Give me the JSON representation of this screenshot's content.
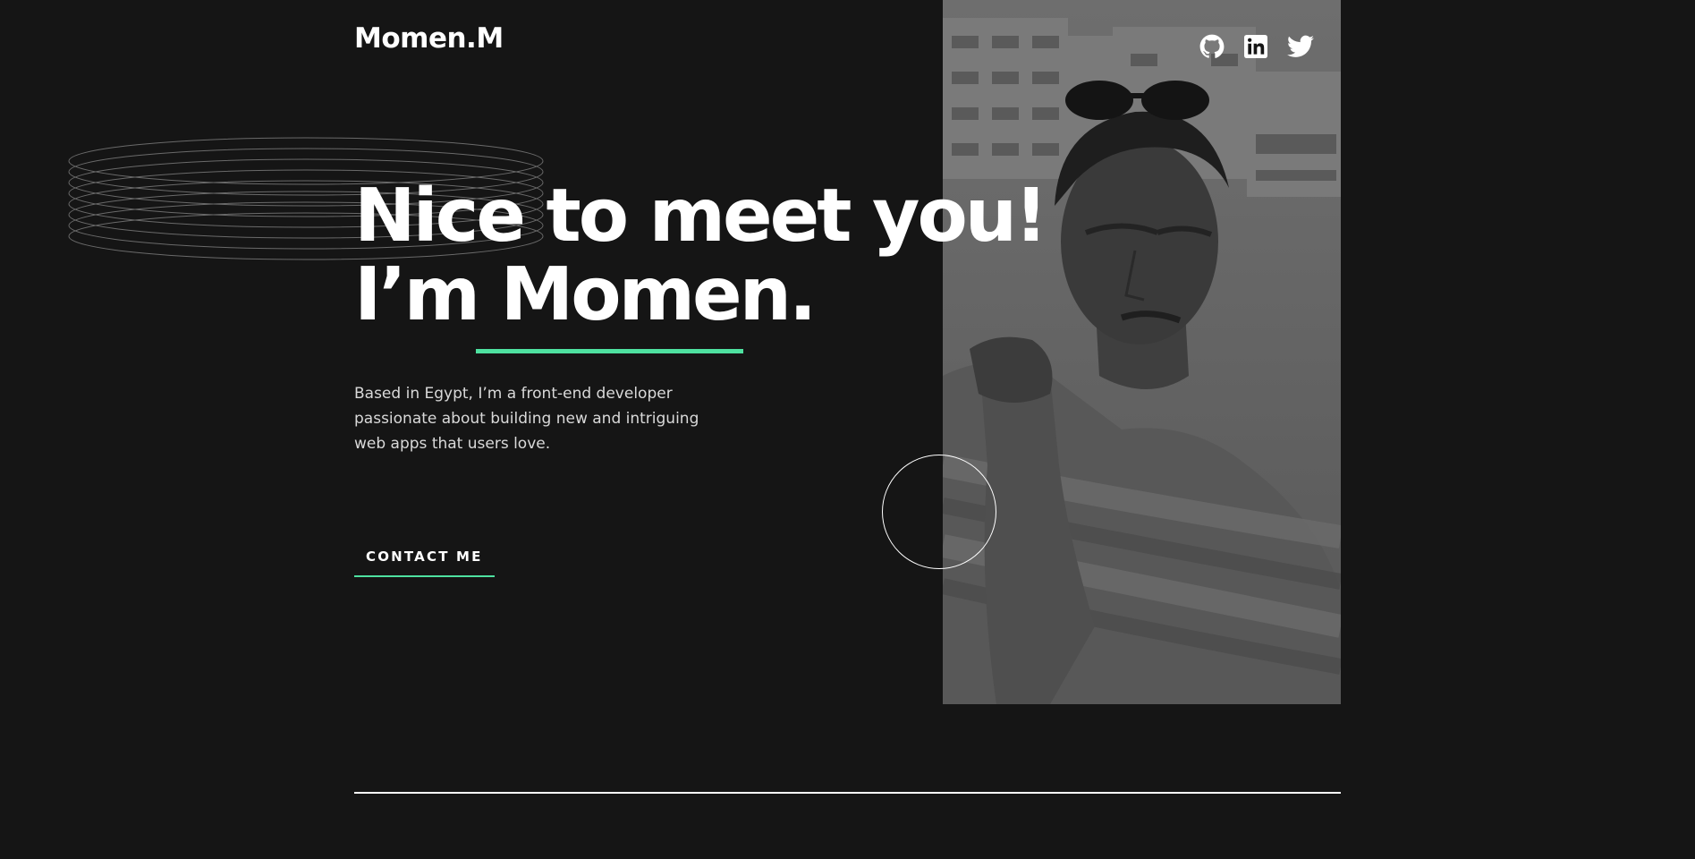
{
  "header": {
    "logo": "Momen.M",
    "social_icons": [
      "github-icon",
      "linkedin-icon",
      "twitter-icon"
    ]
  },
  "hero": {
    "title_line1": "Nice to meet you!",
    "title_line2": "I’m Momen.",
    "intro": "Based in Egypt, I’m a front-end developer passionate about building new and intriguing web apps that users love.",
    "cta_label": "CONTACT ME"
  },
  "colors": {
    "background": "#151515",
    "accent": "#4ee1a0",
    "text": "#ffffff",
    "muted_text": "#d9d9d9"
  }
}
